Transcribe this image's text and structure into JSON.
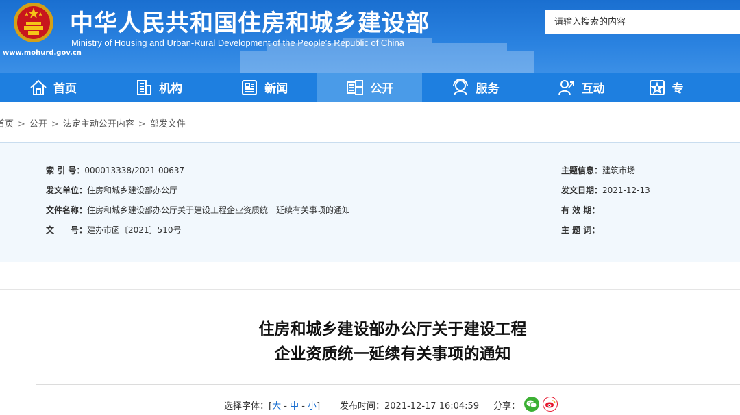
{
  "header": {
    "title_cn": "中华人民共和国住房和城乡建设部",
    "title_en": "Ministry of Housing and Urban-Rural Development of the People's Republic of China",
    "site_url": "www.mohurd.gov.cn",
    "search_placeholder": "请输入搜索的内容"
  },
  "nav": {
    "items": [
      {
        "label": "首页",
        "icon": "home-icon"
      },
      {
        "label": "机构",
        "icon": "building-icon"
      },
      {
        "label": "新闻",
        "icon": "news-icon"
      },
      {
        "label": "公开",
        "icon": "disclosure-icon"
      },
      {
        "label": "服务",
        "icon": "service-icon"
      },
      {
        "label": "互动",
        "icon": "interaction-icon"
      },
      {
        "label": "专",
        "icon": "special-icon"
      }
    ],
    "active_index": 3
  },
  "breadcrumb": [
    "首页",
    "公开",
    "法定主动公开内容",
    "部发文件"
  ],
  "info": {
    "index_label": "索 引 号：",
    "index_value": "000013338/2021-00637",
    "issuer_label": "发文单位：",
    "issuer_value": "住房和城乡建设部办公厅",
    "filename_label": "文件名称：",
    "filename_value": "住房和城乡建设部办公厅关于建设工程企业资质统一延续有关事项的通知",
    "docno_label": "文　　号：",
    "docno_value": "建办市函〔2021〕510号",
    "topic_label": "主题信息：",
    "topic_value": "建筑市场",
    "date_label": "发文日期：",
    "date_value": "2021-12-13",
    "validity_label": "有 效 期：",
    "validity_value": "",
    "keywords_label": "主 题 词：",
    "keywords_value": ""
  },
  "article": {
    "title_line1": "住房和城乡建设部办公厅关于建设工程",
    "title_line2": "企业资质统一延续有关事项的通知",
    "font_label": "选择字体：[",
    "font_large": "大",
    "font_medium": "中",
    "font_small": "小",
    "font_close": "]",
    "publish_label": "发布时间：",
    "publish_time": "2021-12-17 16:04:59",
    "share_label": "分享："
  },
  "colors": {
    "header_blue": "#1a6fd0",
    "nav_blue": "#1e7fe0",
    "nav_active": "#4a9be8",
    "info_bg": "#f2f8fd",
    "wechat_green": "#3cb034",
    "weibo_red": "#e6162d"
  }
}
